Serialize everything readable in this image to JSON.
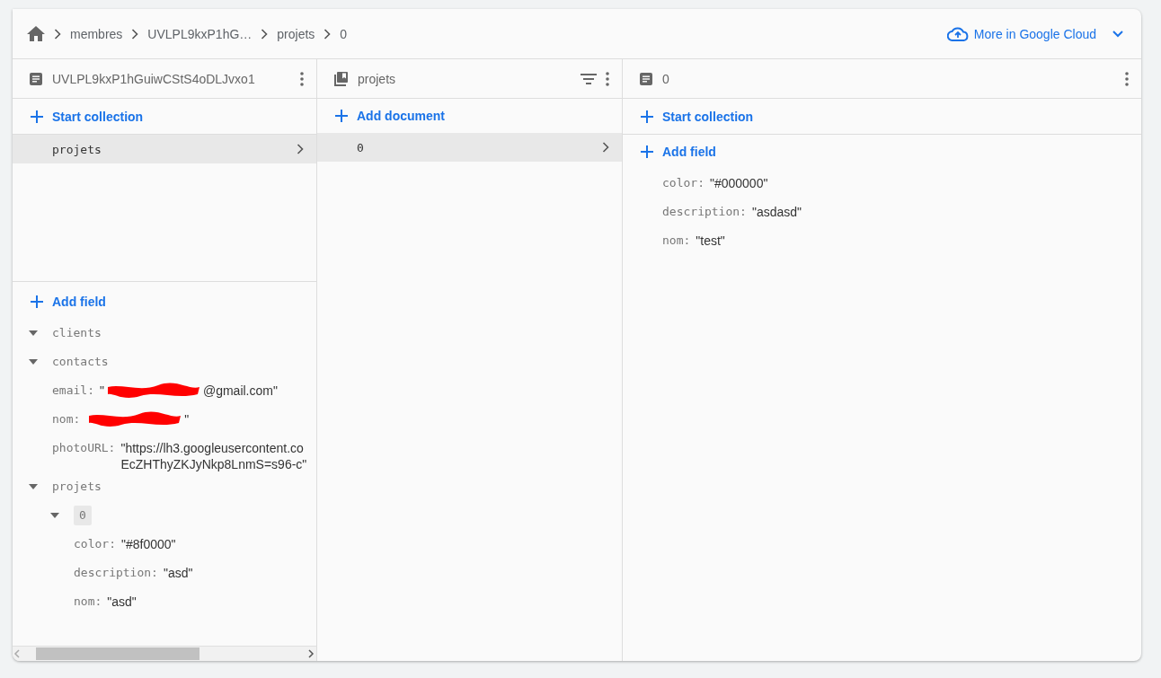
{
  "breadcrumb": [
    "membres",
    "UVLPL9kxP1hG…",
    "projets",
    "0"
  ],
  "cloud_menu": {
    "label": "More in Google Cloud"
  },
  "panels": [
    {
      "kind": "document",
      "title": "UVLPL9kxP1hGuiwCStS4oDLJvxo1",
      "add_label": "Start collection",
      "items": [
        {
          "label": "projets",
          "selected": true
        }
      ],
      "add_field": "Add field",
      "fields": [
        {
          "kind": "map",
          "key": "clients",
          "expanded": true
        },
        {
          "kind": "map",
          "key": "contacts",
          "expanded": true,
          "children": [
            {
              "kind": "value",
              "key": "email:",
              "redacted": true,
              "value_start": "\"",
              "value_lines": [
                "@gmail.com\""
              ]
            },
            {
              "kind": "value",
              "key": "nom:",
              "redacted": true,
              "value_lines": [
                "\""
              ]
            },
            {
              "kind": "value",
              "key": "photoURL:",
              "redacted": false,
              "value_lines": [
                "\"https://lh3.googleusercontent.co",
                "EcZHThyZKJyNkp8LnmS=s96-c\""
              ]
            }
          ]
        },
        {
          "kind": "map",
          "key": "projets",
          "expanded": true,
          "children": [
            {
              "kind": "index",
              "key": "0",
              "expanded": true,
              "children": [
                {
                  "kind": "value",
                  "key": "color:",
                  "redacted": false,
                  "value_lines": [
                    "\"#8f0000\""
                  ]
                },
                {
                  "kind": "value",
                  "key": "description:",
                  "redacted": false,
                  "value_lines": [
                    "\"asd\""
                  ]
                },
                {
                  "kind": "value",
                  "key": "nom:",
                  "redacted": false,
                  "value_lines": [
                    "\"asd\""
                  ]
                }
              ]
            }
          ]
        }
      ]
    },
    {
      "kind": "collection",
      "title": "projets",
      "add_label": "Add document",
      "items": [
        {
          "label": "0",
          "selected": true
        }
      ]
    },
    {
      "kind": "document",
      "title": "0",
      "add_label": "Start collection",
      "add_field": "Add field",
      "fields": [
        {
          "kind": "value",
          "key": "color:",
          "redacted": false,
          "value_lines": [
            "\"#000000\""
          ]
        },
        {
          "kind": "value",
          "key": "description:",
          "redacted": false,
          "value_lines": [
            "\"asdasd\""
          ]
        },
        {
          "kind": "value",
          "key": "nom:",
          "redacted": false,
          "value_lines": [
            "\"test\""
          ]
        }
      ]
    }
  ]
}
